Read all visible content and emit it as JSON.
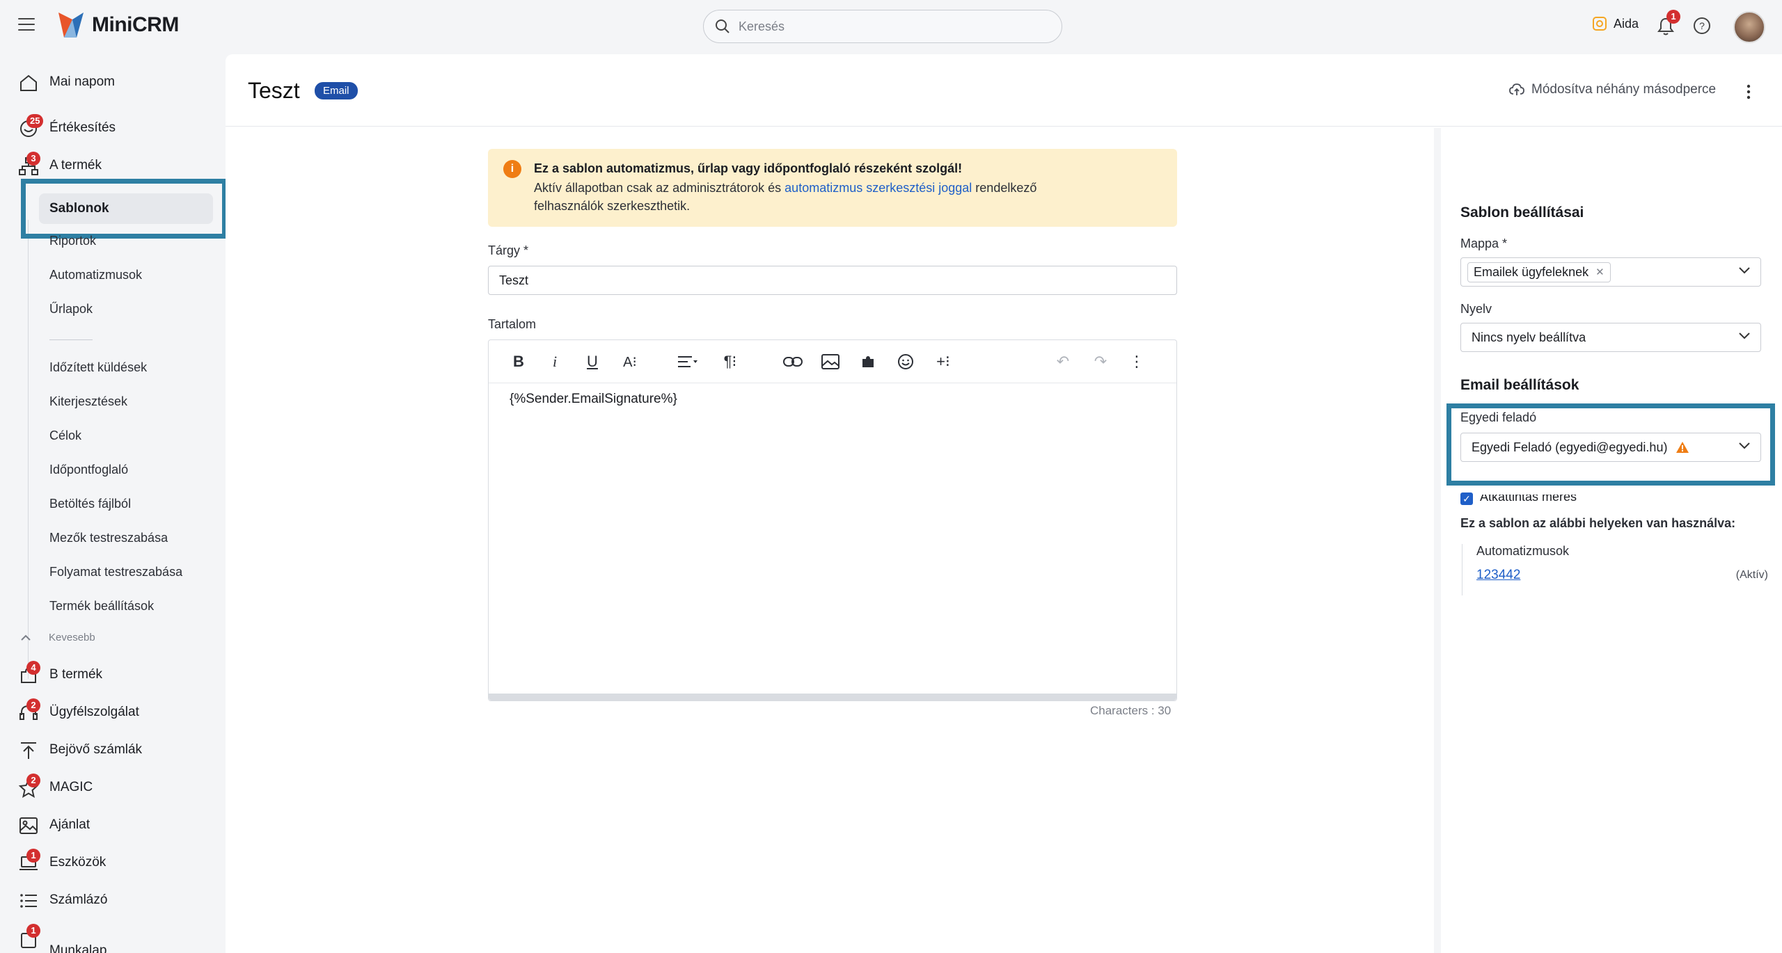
{
  "app": {
    "logo_text": "MiniCRM",
    "search_placeholder": "Keresés",
    "aida_label": "Aida",
    "notification_count": "1"
  },
  "sidebar": {
    "main_items": [
      {
        "label": "Mai napom",
        "icon": "home-icon",
        "badge": ""
      },
      {
        "label": "Értékesítés",
        "icon": "sales-gauge-icon",
        "badge": "25"
      },
      {
        "label": "A termék",
        "icon": "hierarchy-icon",
        "badge": "3"
      }
    ],
    "sub_items": [
      "Sablonok",
      "Riportok",
      "Automatizmusok",
      "Űrlapok",
      "Időzített küldések",
      "Kiterjesztések",
      "Célok",
      "Időpontfoglaló",
      "Betöltés fájlból",
      "Mezők testreszabása",
      "Folyamat testreszabása",
      "Termék beállítások"
    ],
    "collapse_label": "Kevesebb",
    "bottom_items": [
      {
        "label": "B termék",
        "icon": "puzzle-icon",
        "badge": "4"
      },
      {
        "label": "Ügyfélszolgálat",
        "icon": "headset-icon",
        "badge": "2"
      },
      {
        "label": "Bejövő számlák",
        "icon": "upload-arrow-icon",
        "badge": ""
      },
      {
        "label": "MAGIC",
        "icon": "star-icon",
        "badge": "2"
      },
      {
        "label": "Ajánlat",
        "icon": "image-icon",
        "badge": ""
      },
      {
        "label": "Eszközök",
        "icon": "laptop-icon",
        "badge": "1"
      },
      {
        "label": "Számlázó",
        "icon": "list-icon",
        "badge": ""
      },
      {
        "label": "Munkalap",
        "icon": "worksheet-icon",
        "badge": "1"
      }
    ]
  },
  "header": {
    "title": "Teszt",
    "tag": "Email",
    "modified": "Módosítva néhány másodperce"
  },
  "alert": {
    "heading": "Ez a sablon automatizmus, űrlap vagy időpontfoglaló részeként szolgál!",
    "line1_pre": "Aktív állapotban csak az adminisztrátorok és ",
    "line1_link": "automatizmus szerkesztési joggal",
    "line1_post": " rendelkező",
    "line2": "felhasználók szerkeszthetik."
  },
  "form": {
    "subject_label": "Tárgy *",
    "subject_value": "Teszt",
    "content_label": "Tartalom",
    "content_value": "{%Sender.EmailSignature%}",
    "char_count": "Characters : 30"
  },
  "settings": {
    "heading": "Sablon beállításai",
    "folder_label": "Mappa *",
    "folder_value": "Emailek ügyfeleknek",
    "language_label": "Nyelv",
    "language_value": "Nincs nyelv beállítva",
    "email_heading": "Email beállítások",
    "sender_label": "Egyedi feladó",
    "sender_value": "Egyedi Feladó (egyedi@egyedi.hu)",
    "click_tracking_label": "Átkattintás mérés",
    "used_heading": "Ez a sablon az alábbi helyeken van használva:",
    "used_category": "Automatizmusok",
    "used_link": "123442",
    "used_status": "(Aktív)"
  },
  "colors": {
    "highlight": "#2e7fa3",
    "badge": "#d32f2f",
    "link": "#1f5fc8",
    "tag": "#1f4fa8",
    "alert_bg": "#fdf0cd"
  }
}
